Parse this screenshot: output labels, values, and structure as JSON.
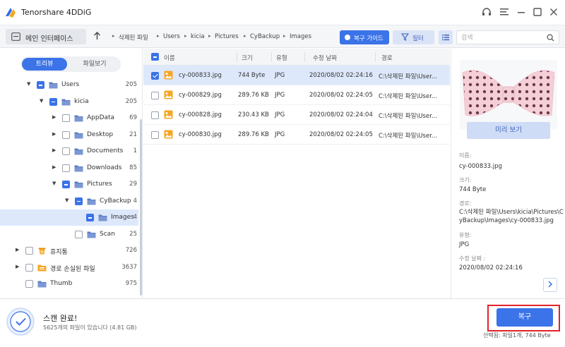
{
  "app": {
    "title": "Tenorshare 4DDiG"
  },
  "colors": {
    "accent": "#3b73e8",
    "highlight": "#e2222a",
    "selected_row": "#dde8fb",
    "folder": "#5b7fc4"
  },
  "toolbar": {
    "home_label": "메인 인터페이스",
    "breadcrumb": [
      "삭제된 파일",
      "Users",
      "kicia",
      "Pictures",
      "CyBackup",
      "Images"
    ],
    "recover_guide_label": "복구 가이드",
    "filter_label": "필터",
    "search_placeholder": "검색"
  },
  "sidebar": {
    "tabs": [
      "트리뷰",
      "파일보기"
    ],
    "tree": [
      {
        "name": "Users",
        "count": "205",
        "expanded": true,
        "state": "partial",
        "level": 1,
        "icon": "folder-icon"
      },
      {
        "name": "kicia",
        "count": "205",
        "expanded": true,
        "state": "partial",
        "level": 2,
        "icon": "folder-icon"
      },
      {
        "name": "AppData",
        "count": "69",
        "expanded": false,
        "state": "none",
        "level": 3,
        "icon": "folder-icon"
      },
      {
        "name": "Desktop",
        "count": "21",
        "expanded": false,
        "state": "none",
        "level": 3,
        "icon": "folder-icon"
      },
      {
        "name": "Documents",
        "count": "1",
        "expanded": false,
        "state": "none",
        "level": 3,
        "icon": "folder-icon"
      },
      {
        "name": "Downloads",
        "count": "85",
        "expanded": false,
        "state": "none",
        "level": 3,
        "icon": "folder-icon"
      },
      {
        "name": "Pictures",
        "count": "29",
        "expanded": true,
        "state": "partial",
        "level": 3,
        "icon": "folder-icon"
      },
      {
        "name": "CyBackup",
        "count": "4",
        "expanded": true,
        "state": "partial",
        "level": 4,
        "icon": "folder-icon"
      },
      {
        "name": "Images",
        "count": "4",
        "expanded": null,
        "state": "partial",
        "level": 5,
        "icon": "folder-icon",
        "selected": true
      },
      {
        "name": "Scan",
        "count": "25",
        "expanded": null,
        "state": "none",
        "level": 4,
        "icon": "folder-icon"
      },
      {
        "name": "휴지통",
        "count": "726",
        "expanded": false,
        "state": "none",
        "level": 0,
        "icon": "recycle-bin-icon"
      },
      {
        "name": "경로 손실된 파일",
        "count": "3637",
        "expanded": false,
        "state": "none",
        "level": 0,
        "icon": "lost-folder-icon"
      },
      {
        "name": "Thumb",
        "count": "975",
        "expanded": null,
        "state": "none",
        "level": 0,
        "icon": "folder-icon"
      }
    ]
  },
  "filelist": {
    "columns": [
      "이름",
      "크기",
      "유형",
      "수정 날짜",
      "경로"
    ],
    "rows": [
      {
        "name": "cy-000833.jpg",
        "size": "744 Byte",
        "type": "JPG",
        "modified": "2020/08/02 02:24:16",
        "path": "C:\\삭제된 파일\\User...",
        "checked": true
      },
      {
        "name": "cy-000829.jpg",
        "size": "289.76 KB",
        "type": "JPG",
        "modified": "2020/08/02 02:24:05",
        "path": "C:\\삭제된 파일\\User...",
        "checked": false
      },
      {
        "name": "cy-000828.jpg",
        "size": "230.43 KB",
        "type": "JPG",
        "modified": "2020/08/02 02:24:04",
        "path": "C:\\삭제된 파일\\User...",
        "checked": false
      },
      {
        "name": "cy-000830.jpg",
        "size": "289.76 KB",
        "type": "JPG",
        "modified": "2020/08/02 02:24:05",
        "path": "C:\\삭제된 파일\\User...",
        "checked": false
      }
    ]
  },
  "preview": {
    "button_label": "미리 보기",
    "name_label": "이름:",
    "name_value": "cy-000833.jpg",
    "size_label": "크기:",
    "size_value": "744 Byte",
    "path_label": "경로:",
    "path_value": "C:\\삭제된 파일\\Users\\kicia\\Pictures\\CyBackup\\Images\\cy-000833.jpg",
    "type_label": "유형:",
    "type_value": "JPG",
    "modified_label": "수정 날짜 :",
    "modified_value": "2020/08/02 02:24:16"
  },
  "bottom": {
    "scan_status": "스캔 완료!",
    "scan_summary": "5625개의 파일이 있습니다 (4.81 GB)",
    "recover_label": "복구",
    "selected_info": "선택됨: 파일1개, 744 Byte"
  }
}
